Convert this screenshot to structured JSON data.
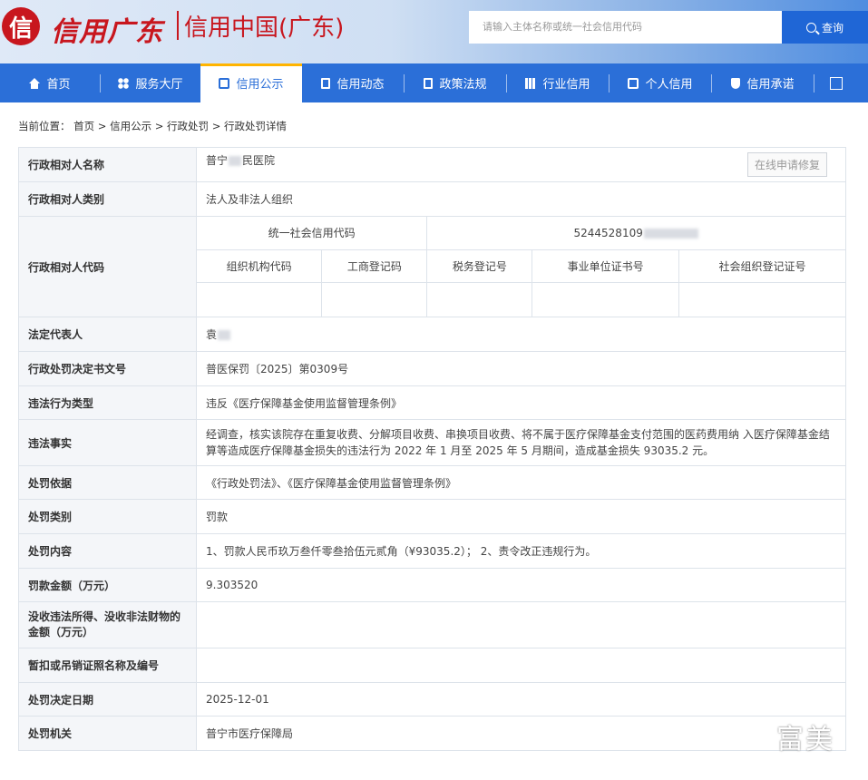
{
  "header": {
    "logo_mark": "信",
    "logo_calligraphy": "信用广东",
    "site_title": "信用中国(广东)",
    "search_placeholder": "请输入主体名称或统一社会信用代码",
    "search_button": "查询"
  },
  "nav": {
    "items": [
      {
        "label": "首页",
        "icon": "home-icon"
      },
      {
        "label": "服务大厅",
        "icon": "grid-icon"
      },
      {
        "label": "信用公示",
        "icon": "briefcase-icon",
        "active": true
      },
      {
        "label": "信用动态",
        "icon": "document-icon"
      },
      {
        "label": "政策法规",
        "icon": "book-icon"
      },
      {
        "label": "行业信用",
        "icon": "bar-chart-icon"
      },
      {
        "label": "个人信用",
        "icon": "id-card-icon"
      },
      {
        "label": "信用承诺",
        "icon": "shield-icon"
      }
    ],
    "expand_icon": "expand-icon"
  },
  "breadcrumb": {
    "prefix": "当前位置：",
    "path": "首页 > 信用公示 > 行政处罚 > 行政处罚详情"
  },
  "detail": {
    "name_label": "行政相对人名称",
    "name_value_pre": "普宁",
    "name_value_post": "民医院",
    "repair_button": "在线申请修复",
    "category_label": "行政相对人类别",
    "category_value": "法人及非法人组织",
    "code_label": "行政相对人代码",
    "uscc_label": "统一社会信用代码",
    "uscc_value_visible": "5244528109",
    "code_columns": [
      "组织机构代码",
      "工商登记码",
      "税务登记号",
      "事业单位证书号",
      "社会组织登记证号"
    ],
    "legal_rep_label": "法定代表人",
    "legal_rep_value": "袁",
    "doc_no_label": "行政处罚决定书文号",
    "doc_no_value": "普医保罚〔2025〕第0309号",
    "violation_type_label": "违法行为类型",
    "violation_type_value": "违反《医疗保障基金使用监督管理条例》",
    "facts_label": "违法事实",
    "facts_value": "经调查，核实该院存在重复收费、分解项目收费、串换项目收费、将不属于医疗保障基金支付范围的医药费用纳 入医疗保障基金结算等造成医疗保障基金损失的违法行为 2022 年 1 月至 2025 年 5 月期间，造成基金损失 93035.2 元。",
    "basis_label": "处罚依据",
    "basis_value": "《行政处罚法》、《医疗保障基金使用监督管理条例》",
    "penalty_type_label": "处罚类别",
    "penalty_type_value": "罚款",
    "content_label": "处罚内容",
    "content_value": "1、罚款人民币玖万叁仟零叁拾伍元贰角（¥93035.2）； 2、责令改正违规行为。",
    "fine_label": "罚款金额（万元）",
    "fine_value": "9.303520",
    "confiscation_label": "没收违法所得、没收非法财物的金额（万元）",
    "confiscation_value": "",
    "license_label": "暂扣或吊销证照名称及编号",
    "license_value": "",
    "date_label": "处罚决定日期",
    "date_value": "2025-12-01",
    "authority_label": "处罚机关",
    "authority_value": "普宁市医疗保障局"
  },
  "watermark": "富美"
}
